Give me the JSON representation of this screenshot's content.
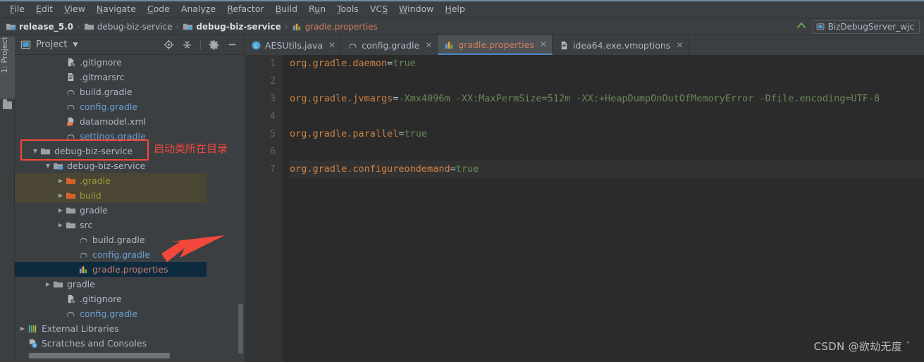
{
  "menu": {
    "items": [
      {
        "label": "File",
        "mnemonic": "F"
      },
      {
        "label": "Edit",
        "mnemonic": "E"
      },
      {
        "label": "View",
        "mnemonic": "V"
      },
      {
        "label": "Navigate",
        "mnemonic": "N"
      },
      {
        "label": "Code",
        "mnemonic": "C"
      },
      {
        "label": "Analyze",
        "mnemonic": "z"
      },
      {
        "label": "Refactor",
        "mnemonic": "R"
      },
      {
        "label": "Build",
        "mnemonic": "B"
      },
      {
        "label": "Run",
        "mnemonic": "u"
      },
      {
        "label": "Tools",
        "mnemonic": "T"
      },
      {
        "label": "VCS",
        "mnemonic": "S"
      },
      {
        "label": "Window",
        "mnemonic": "W"
      },
      {
        "label": "Help",
        "mnemonic": "H"
      }
    ]
  },
  "breadcrumb": {
    "items": [
      {
        "label": "release_5.0",
        "icon": "module-folder-icon",
        "style": "bold"
      },
      {
        "label": "debug-biz-service",
        "icon": "folder-icon",
        "style": "normal"
      },
      {
        "label": "debug-biz-service",
        "icon": "module-folder-icon",
        "style": "bold"
      },
      {
        "label": "gradle.properties",
        "icon": "properties-file-icon",
        "style": "file"
      }
    ],
    "separator": "›"
  },
  "toolbar_right": {
    "collapse_icon": "collapse-arrow-icon",
    "run_configuration": "BizDebugServer_wjc",
    "run_configuration_icon": "run-config-icon"
  },
  "left_tool_strip": {
    "tab_label": "1: Project",
    "folder_icon": "folder-icon"
  },
  "project_panel": {
    "title": "Project",
    "dropdown_icon": "chevron-down-icon",
    "tools": [
      {
        "name": "locate-icon",
        "title": "Select Opened File"
      },
      {
        "name": "collapse-all-icon",
        "title": "Collapse All"
      },
      {
        "name": "gear-icon",
        "title": "Settings"
      },
      {
        "name": "minimize-icon",
        "title": "Hide"
      }
    ],
    "tree": [
      {
        "label": ".gitignore",
        "indent": 3,
        "arrow": "",
        "icon": "gitignore-icon",
        "color": "normal",
        "state": "normal"
      },
      {
        "label": ".gitmarsrc",
        "indent": 3,
        "arrow": "",
        "icon": "text-file-icon",
        "color": "normal",
        "state": "normal"
      },
      {
        "label": "build.gradle",
        "indent": 3,
        "arrow": "",
        "icon": "gradle-icon",
        "color": "normal",
        "state": "normal"
      },
      {
        "label": "config.gradle",
        "indent": 3,
        "arrow": "",
        "icon": "gradle-icon",
        "color": "blue",
        "state": "normal"
      },
      {
        "label": "datamodel.xml",
        "indent": 3,
        "arrow": "",
        "icon": "xml-file-icon",
        "color": "normal",
        "state": "normal"
      },
      {
        "label": "settings.gradle",
        "indent": 3,
        "arrow": "",
        "icon": "gradle-icon",
        "color": "blue",
        "state": "normal"
      },
      {
        "label": "debug-biz-service",
        "indent": 1,
        "arrow": "▼",
        "icon": "folder-icon",
        "color": "normal",
        "state": "normal"
      },
      {
        "label": "debug-biz-service",
        "indent": 2,
        "arrow": "▼",
        "icon": "module-folder-icon",
        "color": "normal",
        "state": "normal"
      },
      {
        "label": ".gradle",
        "indent": 3,
        "arrow": "▶",
        "icon": "excluded-folder-icon",
        "color": "excluded",
        "state": "excluded"
      },
      {
        "label": "build",
        "indent": 3,
        "arrow": "▶",
        "icon": "excluded-folder-icon",
        "color": "excluded",
        "state": "excluded"
      },
      {
        "label": "gradle",
        "indent": 3,
        "arrow": "▶",
        "icon": "folder-icon",
        "color": "normal",
        "state": "normal"
      },
      {
        "label": "src",
        "indent": 3,
        "arrow": "▶",
        "icon": "folder-icon",
        "color": "normal",
        "state": "normal"
      },
      {
        "label": "build.gradle",
        "indent": 4,
        "arrow": "",
        "icon": "gradle-icon",
        "color": "normal",
        "state": "normal"
      },
      {
        "label": "config.gradle",
        "indent": 4,
        "arrow": "",
        "icon": "gradle-icon",
        "color": "blue",
        "state": "normal"
      },
      {
        "label": "gradle.properties",
        "indent": 4,
        "arrow": "",
        "icon": "properties-file-icon",
        "color": "file",
        "state": "selected"
      },
      {
        "label": "gradle",
        "indent": 2,
        "arrow": "▶",
        "icon": "folder-icon",
        "color": "normal",
        "state": "normal"
      },
      {
        "label": ".gitignore",
        "indent": 3,
        "arrow": "",
        "icon": "gitignore-icon",
        "color": "normal",
        "state": "normal"
      },
      {
        "label": "config.gradle",
        "indent": 3,
        "arrow": "",
        "icon": "gradle-icon",
        "color": "blue",
        "state": "normal"
      },
      {
        "label": "External Libraries",
        "indent": 0,
        "arrow": "▶",
        "icon": "libraries-icon",
        "color": "normal",
        "state": "normal"
      },
      {
        "label": "Scratches and Consoles",
        "indent": 0,
        "arrow": "",
        "icon": "scratches-icon",
        "color": "normal",
        "state": "normal"
      }
    ]
  },
  "editor": {
    "tabs": [
      {
        "label": "AESUtils.java",
        "icon": "java-class-icon",
        "active": false,
        "close": "✕"
      },
      {
        "label": "config.gradle",
        "icon": "gradle-icon",
        "active": false,
        "close": "✕"
      },
      {
        "label": "gradle.properties",
        "icon": "properties-file-icon",
        "active": true,
        "close": "✕"
      },
      {
        "label": "idea64.exe.vmoptions",
        "icon": "text-file-icon",
        "active": false,
        "close": "✕"
      }
    ],
    "line_numbers": [
      "1",
      "2",
      "3",
      "4",
      "5",
      "6",
      "7"
    ],
    "lines": [
      {
        "key": "org.gradle.daemon",
        "eq": "=",
        "value": "true"
      },
      {
        "key": "",
        "eq": "",
        "value": ""
      },
      {
        "key": "org.gradle.jvmargs",
        "eq": "=",
        "value": "-Xmx4096m -XX:MaxPermSize=512m -XX:+HeapDumpOnOutOfMemoryError -Dfile.encoding=UTF-8"
      },
      {
        "key": "",
        "eq": "",
        "value": ""
      },
      {
        "key": "org.gradle.parallel",
        "eq": "=",
        "value": "true"
      },
      {
        "key": "",
        "eq": "",
        "value": ""
      },
      {
        "key": "org.gradle.configureondemand",
        "eq": "=",
        "value": "true"
      }
    ]
  },
  "annotations": {
    "highlight_note": "启动类所在目录",
    "box_target": "debug-biz-service",
    "arrow_target": "gradle.properties",
    "color": "#f4483c"
  },
  "watermark": "CSDN @欲劫无度 ˋ",
  "colors": {
    "background": "#3c3f41",
    "editor_background": "#2b2b2b",
    "selection": "#0d2a3f",
    "excluded": "#4b4634",
    "accent": "#4a88c7",
    "annotation_red": "#f4483c"
  }
}
